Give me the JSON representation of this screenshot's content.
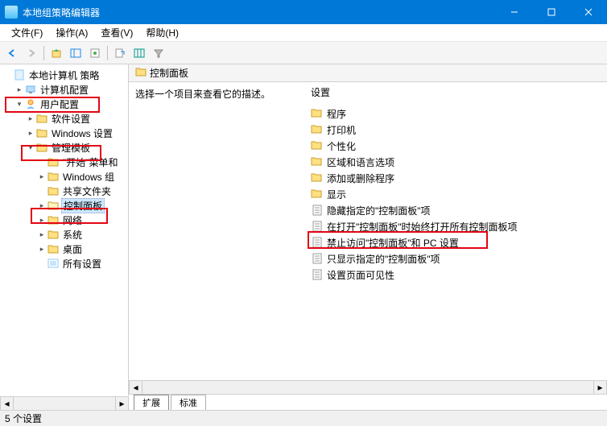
{
  "title": "本地组策略编辑器",
  "menu": {
    "file": "文件(F)",
    "action": "操作(A)",
    "view": "查看(V)",
    "help": "帮助(H)"
  },
  "tree": {
    "root": "本地计算机 策略",
    "computer_config": "计算机配置",
    "user_config": "用户配置",
    "software_settings": "软件设置",
    "windows_settings": "Windows 设置",
    "admin_templates": "管理模板",
    "start_menu": "\"开始\"菜单和",
    "windows_components": "Windows 组",
    "shared_folders": "共享文件夹",
    "control_panel": "控制面板",
    "network": "网络",
    "system": "系统",
    "desktop": "桌面",
    "all_settings": "所有设置"
  },
  "header": {
    "title": "控制面板"
  },
  "description": "选择一个项目来查看它的描述。",
  "settings_header": "设置",
  "settings": {
    "folders": [
      "程序",
      "打印机",
      "个性化",
      "区域和语言选项",
      "添加或删除程序",
      "显示"
    ],
    "items": [
      "隐藏指定的\"控制面板\"项",
      "在打开\"控制面板\"时始终打开所有控制面板项",
      "禁止访问\"控制面板\"和 PC 设置",
      "只显示指定的\"控制面板\"项",
      "设置页面可见性"
    ]
  },
  "tabs": {
    "extended": "扩展",
    "standard": "标准"
  },
  "status": "5 个设置"
}
